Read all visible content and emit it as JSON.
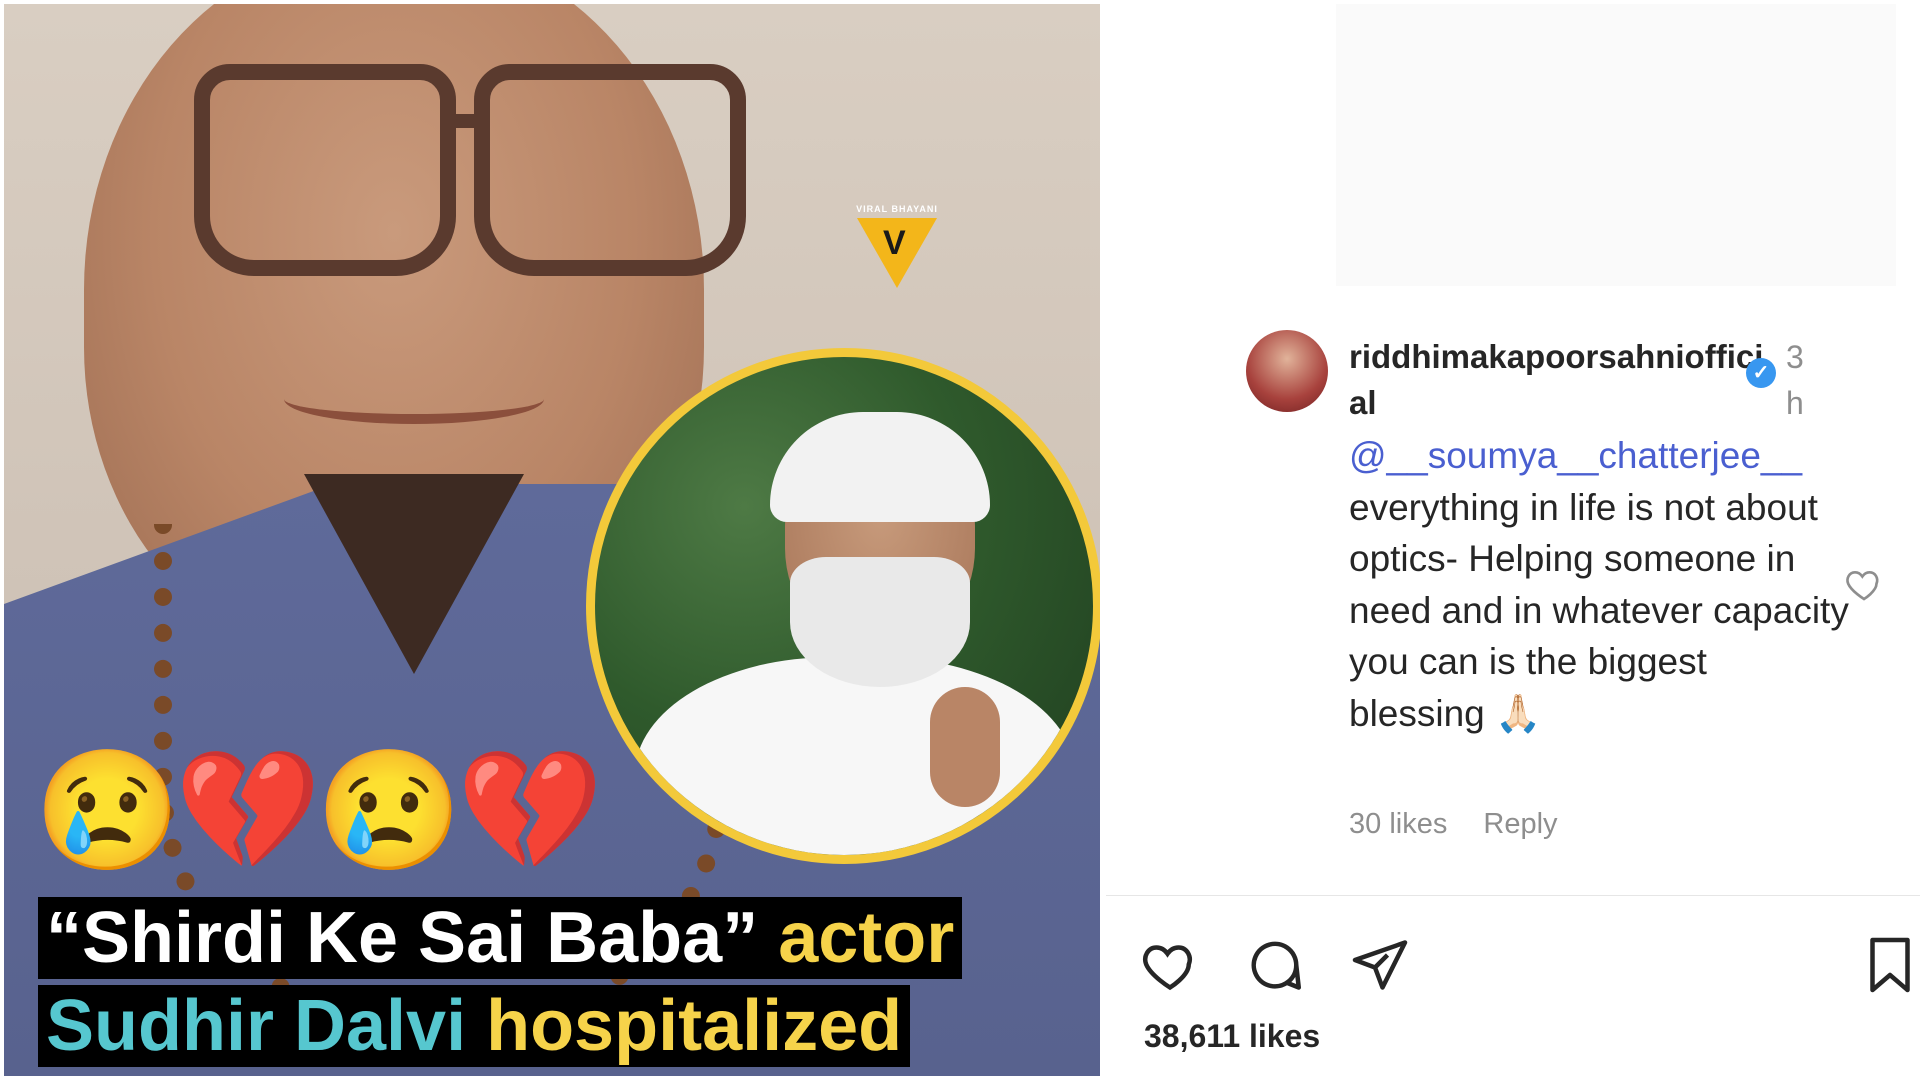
{
  "post_image": {
    "brand": "VIRAL BHAYANI",
    "brand_mark": "V",
    "emojis": "😢💔😢💔",
    "headline_line1_quote": "“Shirdi Ke Sai Baba”",
    "headline_line1_rest": " actor",
    "headline_line2_name": "Sudhir Dalvi",
    "headline_line2_rest": " hospitalized"
  },
  "comment": {
    "username": "riddhimakapoorsahniofficial",
    "verified_mark": "✓",
    "timestamp": "3h",
    "mention": "@__soumya__chatterjee__",
    "text": "everything in life is not about optics- Helping someone in need and in whatever capacity you can is the biggest blessing 🙏🏻",
    "likes": "30 likes",
    "reply_label": "Reply"
  },
  "post_actions": {
    "icons": [
      "heart-icon",
      "comment-icon",
      "share-icon",
      "bookmark-icon"
    ],
    "likes": "38,611 likes"
  },
  "colors": {
    "accent_blue": "#4a5fd0",
    "verified_blue": "#3897f0",
    "headline_yellow": "#f6d34a",
    "headline_cyan": "#56c7cf"
  }
}
